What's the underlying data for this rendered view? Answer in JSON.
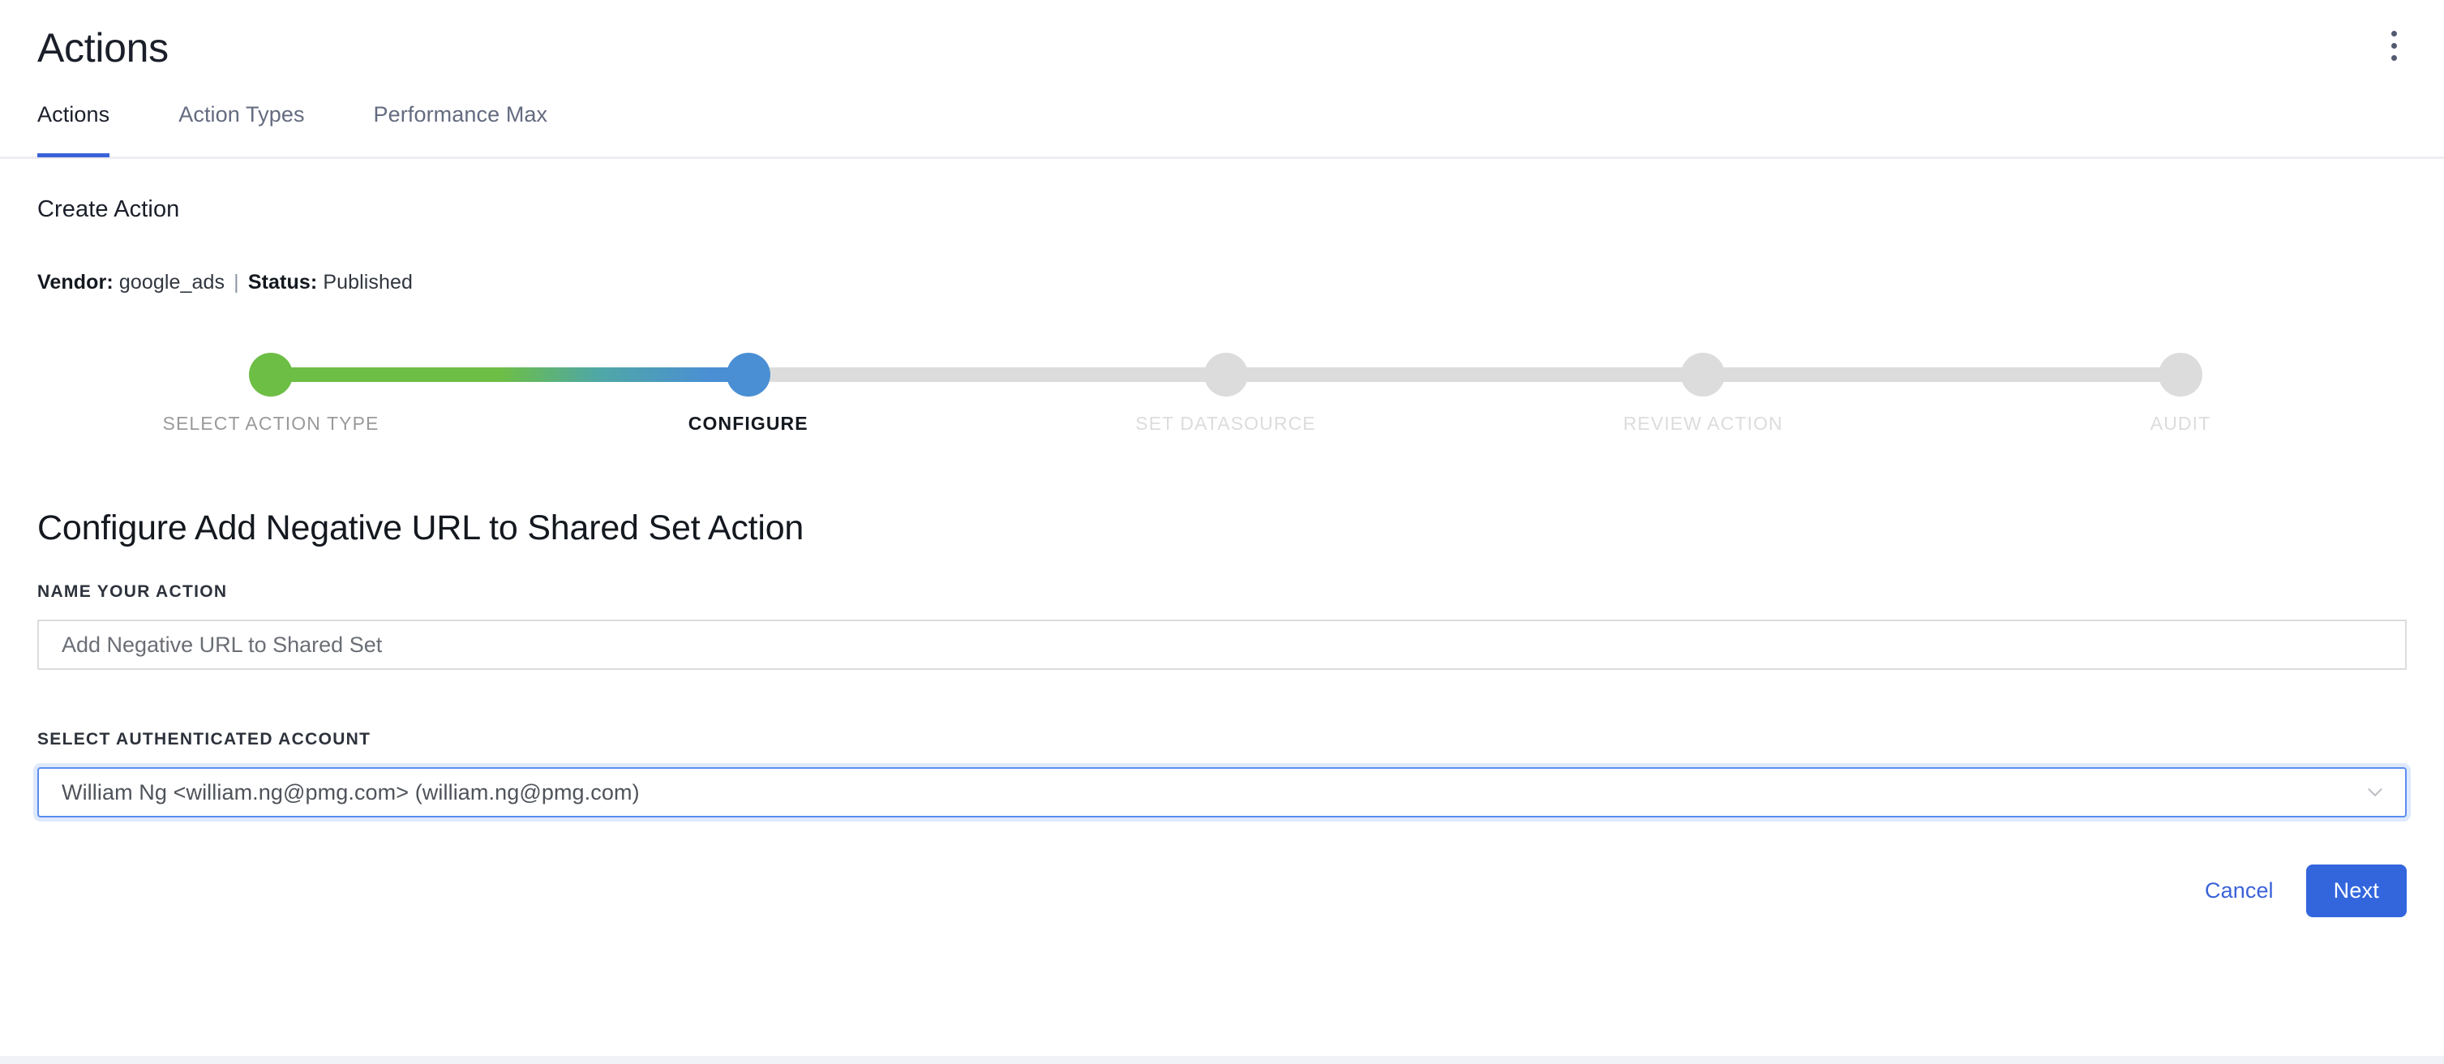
{
  "header": {
    "title": "Actions",
    "menu_icon": "kebab-vertical-icon"
  },
  "tabs": [
    {
      "label": "Actions",
      "active": true
    },
    {
      "label": "Action Types",
      "active": false
    },
    {
      "label": "Performance Max",
      "active": false
    }
  ],
  "section": {
    "title": "Create Action",
    "vendor_label": "Vendor:",
    "vendor_value": "google_ads",
    "separator": "|",
    "status_label": "Status:",
    "status_value": "Published"
  },
  "stepper": {
    "steps": [
      {
        "label": "SELECT ACTION TYPE",
        "state": "done"
      },
      {
        "label": "CONFIGURE",
        "state": "current"
      },
      {
        "label": "SET DATASOURCE",
        "state": "pending"
      },
      {
        "label": "REVIEW ACTION",
        "state": "pending"
      },
      {
        "label": "AUDIT",
        "state": "pending"
      }
    ],
    "colors": {
      "done": "#6dbe45",
      "current": "#4a8fd4",
      "pending": "#dcdcdc"
    }
  },
  "form": {
    "heading": "Configure Add Negative URL to Shared Set Action",
    "name_label": "NAME YOUR ACTION",
    "name_value": "Add Negative URL to Shared Set",
    "name_placeholder": "Add Negative URL to Shared Set",
    "account_label": "SELECT AUTHENTICATED ACCOUNT",
    "account_value": "William Ng <william.ng@pmg.com> (william.ng@pmg.com)",
    "chevron_icon": "chevron-down-icon"
  },
  "footer": {
    "cancel_label": "Cancel",
    "next_label": "Next",
    "accent_color": "#3366dd"
  }
}
